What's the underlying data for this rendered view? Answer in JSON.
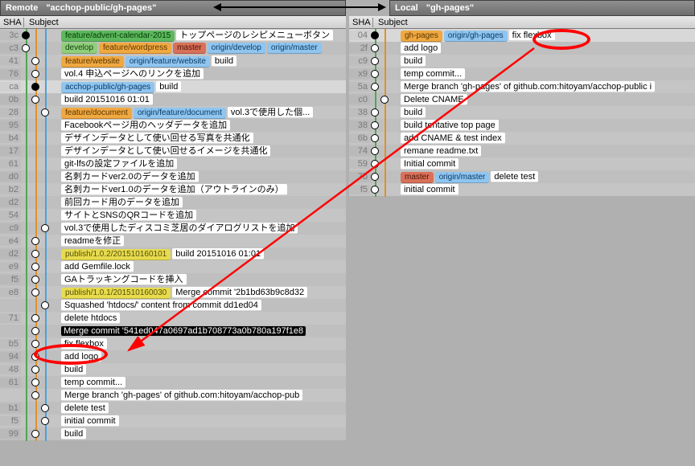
{
  "left": {
    "title": "Remote",
    "branch": "\"acchop-public/gh-pages\"",
    "cols": {
      "sha": "SHA",
      "subject": "Subject"
    },
    "rows": [
      {
        "sha": "3c",
        "tags": [
          [
            "t-green",
            "feature/advent-calendar-2015"
          ]
        ],
        "msg": "トップページのレシピメニューボタン",
        "dot": "filled",
        "lane": 0
      },
      {
        "sha": "c3",
        "tags": [
          [
            "t-green2",
            "develop"
          ],
          [
            "t-orange",
            "feature/wordpress"
          ],
          [
            "t-red",
            "master"
          ],
          [
            "t-blue",
            "origin/develop"
          ],
          [
            "t-blue",
            "origin/master"
          ]
        ],
        "msg": "",
        "dot": "open",
        "lane": 0
      },
      {
        "sha": "41",
        "tags": [
          [
            "t-orange",
            "feature/website"
          ],
          [
            "t-blue",
            "origin/feature/website"
          ]
        ],
        "msg": "build",
        "dot": "open",
        "lane": 1
      },
      {
        "sha": "76",
        "msg": "vol.4 申込ページへのリンクを追加",
        "dot": "open",
        "lane": 1
      },
      {
        "sha": "ca",
        "tags": [
          [
            "t-blue",
            "acchop-public/gh-pages"
          ]
        ],
        "msg": "build",
        "dot": "filled",
        "lane": 1,
        "selected": true
      },
      {
        "sha": "0b",
        "msg": "build 20151016 01:01",
        "dot": "open",
        "lane": 1
      },
      {
        "sha": "28",
        "tags": [
          [
            "t-orange",
            "feature/document"
          ],
          [
            "t-blue",
            "origin/feature/document"
          ]
        ],
        "msg": "vol.3で使用した個...",
        "dot": "open",
        "lane": 2
      },
      {
        "sha": "95",
        "msg": "Facebookページ用のヘッダデータを追加",
        "dot": "none",
        "lane": 2
      },
      {
        "sha": "b4",
        "msg": "デザインデータとして使い回せる写真を共通化",
        "dot": "none",
        "lane": 2
      },
      {
        "sha": "17",
        "msg": "デザインデータとして使い回せるイメージを共通化",
        "dot": "none",
        "lane": 2
      },
      {
        "sha": "61",
        "msg": "git-lfsの設定ファイルを追加",
        "dot": "none",
        "lane": 2
      },
      {
        "sha": "d0",
        "msg": "名刺カードver2.0のデータを追加",
        "dot": "none",
        "lane": 2
      },
      {
        "sha": "b2",
        "msg": "名刺カードver1.0のデータを追加（アウトラインのみ）",
        "dot": "none",
        "lane": 2
      },
      {
        "sha": "d2",
        "msg": "前回カード用のデータを追加",
        "dot": "none",
        "lane": 2
      },
      {
        "sha": "54",
        "msg": "サイトとSNSのQRコードを追加",
        "dot": "none",
        "lane": 2
      },
      {
        "sha": "c9",
        "msg": "vol.3で使用したディスコミ芝居のダイアログリストを追加",
        "dot": "open",
        "lane": 2
      },
      {
        "sha": "e4",
        "msg": "readmeを修正",
        "dot": "open",
        "lane": 1
      },
      {
        "sha": "d2",
        "tags": [
          [
            "t-yellow",
            "publish/1.0.2/201510160101"
          ]
        ],
        "msg": "build 20151016 01:01",
        "dot": "open",
        "lane": 1
      },
      {
        "sha": "e9",
        "msg": "add Gemfile.lock",
        "dot": "open",
        "lane": 1
      },
      {
        "sha": "f5",
        "msg": "GAトラッキングコードを挿入",
        "dot": "open",
        "lane": 1
      },
      {
        "sha": "e8",
        "tags": [
          [
            "t-yellow",
            "publish/1.0.1/201510160030"
          ]
        ],
        "msg": "Merge commit '2b1bd63b9c8d32",
        "dot": "open",
        "lane": 1
      },
      {
        "sha": "",
        "msg": "Squashed 'htdocs/' content from commit dd1ed04",
        "dot": "open",
        "lane": 2
      },
      {
        "sha": "71",
        "msg": "delete htdocs",
        "dot": "open",
        "lane": 1
      },
      {
        "sha": "",
        "msg": "Merge commit '541ed047a0697ad1b708773a0b780a197f1e8",
        "dot": "open",
        "lane": 1,
        "highlight": "black"
      },
      {
        "sha": "b5",
        "msg": "fix flexbox",
        "dot": "open",
        "lane": 1,
        "ring": true
      },
      {
        "sha": "94",
        "msg": "add logo",
        "dot": "open",
        "lane": 1
      },
      {
        "sha": "48",
        "msg": "build",
        "dot": "open",
        "lane": 1
      },
      {
        "sha": "61",
        "msg": "temp commit...",
        "dot": "open",
        "lane": 1
      },
      {
        "sha": "",
        "msg": "Merge branch 'gh-pages' of github.com:hitoyam/acchop-pub",
        "dot": "open",
        "lane": 1
      },
      {
        "sha": "b1",
        "msg": "delete test",
        "dot": "open",
        "lane": 2
      },
      {
        "sha": "f5",
        "msg": "initial commit",
        "dot": "open",
        "lane": 2
      },
      {
        "sha": "99",
        "msg": "build",
        "dot": "open",
        "lane": 1
      }
    ]
  },
  "right": {
    "title": "Local",
    "branch": "\"gh-pages\"",
    "cols": {
      "sha": "SHA",
      "subject": "Subject"
    },
    "rows": [
      {
        "sha": "04",
        "tags": [
          [
            "t-orange",
            "gh-pages"
          ],
          [
            "t-blue",
            "origin/gh-pages"
          ]
        ],
        "msg": "fix flexbox",
        "dot": "filled",
        "lane": 0,
        "ring": true,
        "selected": true
      },
      {
        "sha": "2f",
        "msg": "add logo",
        "dot": "open",
        "lane": 0
      },
      {
        "sha": "c9",
        "msg": "build",
        "dot": "open",
        "lane": 0
      },
      {
        "sha": "x9",
        "msg": "temp commit...",
        "dot": "open",
        "lane": 0
      },
      {
        "sha": "5a",
        "msg": "Merge branch 'gh-pages' of github.com:hitoyam/acchop-public i",
        "dot": "open",
        "lane": 0
      },
      {
        "sha": "c0",
        "msg": "Delete CNAME",
        "dot": "open",
        "lane": 1
      },
      {
        "sha": "38",
        "msg": "build",
        "dot": "open",
        "lane": 0
      },
      {
        "sha": "38",
        "msg": "build tentative top page",
        "dot": "open",
        "lane": 0
      },
      {
        "sha": "6b",
        "msg": "add CNAME & test index",
        "dot": "open",
        "lane": 0
      },
      {
        "sha": "74",
        "msg": "remane readme.txt",
        "dot": "open",
        "lane": 0
      },
      {
        "sha": "59",
        "msg": "Initial commit",
        "dot": "open",
        "lane": 0
      },
      {
        "sha": "7b",
        "tags": [
          [
            "t-red",
            "master"
          ],
          [
            "t-blue",
            "origin/master"
          ]
        ],
        "msg": "delete test",
        "dot": "open",
        "lane": 0
      },
      {
        "sha": "f5",
        "msg": "initial commit",
        "dot": "open",
        "lane": 0
      }
    ]
  },
  "graph_colors": [
    "#51a651",
    "#e0902a",
    "#4aa0dc",
    "#22bec2"
  ]
}
